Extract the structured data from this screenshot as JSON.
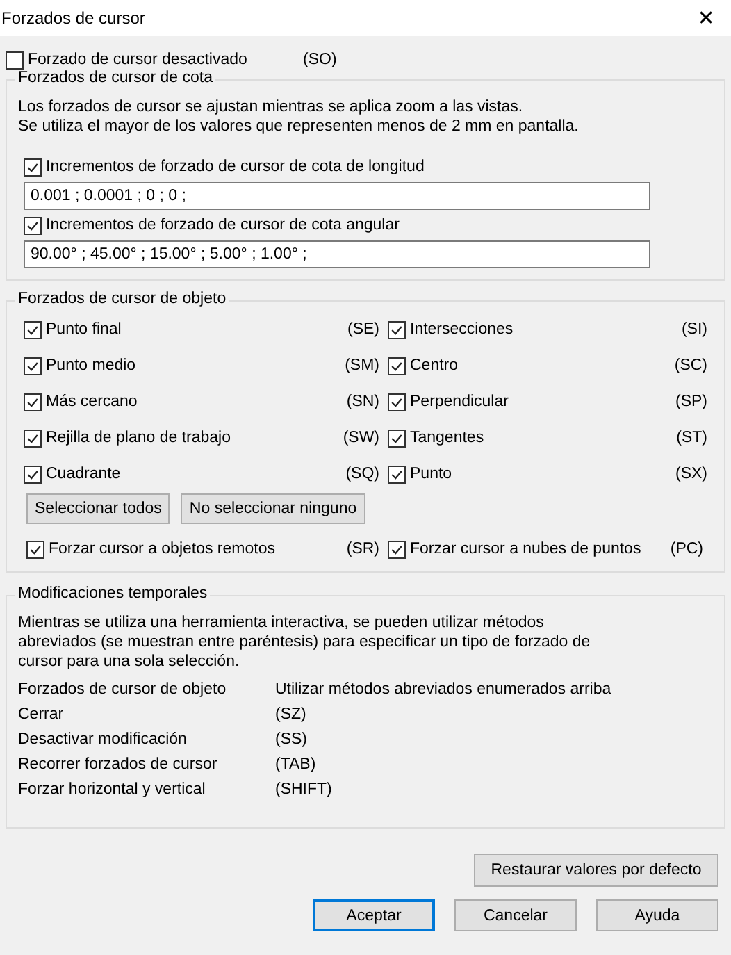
{
  "window": {
    "title": "Forzados de cursor",
    "close": "✕"
  },
  "disable_snap": {
    "label": "Forzado de cursor desactivado",
    "shortcut": "(SO)",
    "checked": false
  },
  "dimension_snaps": {
    "title": "Forzados de cursor de cota",
    "description": "Los forzados de cursor se ajustan mientras se aplica zoom a las vistas.\nSe utiliza el mayor de los valores que representen menos de 2 mm en pantalla.",
    "items": [
      {
        "label": "Incrementos de forzado de cursor de cota de longitud",
        "checked": true,
        "value": "0.001 ; 0.0001 ; 0 ; 0 ;"
      },
      {
        "label": "Incrementos de forzado de cursor de cota angular",
        "checked": true,
        "value": "90.00° ; 45.00° ; 15.00° ; 5.00° ; 1.00° ;"
      }
    ]
  },
  "object_snaps": {
    "title": "Forzados de cursor de objeto",
    "items": [
      {
        "label": "Punto final",
        "shortcut": "(SE)",
        "checked": true
      },
      {
        "label": "Intersecciones",
        "shortcut": "(SI)",
        "checked": true
      },
      {
        "label": "Punto medio",
        "shortcut": "(SM)",
        "checked": true
      },
      {
        "label": "Centro",
        "shortcut": "(SC)",
        "checked": true
      },
      {
        "label": "Más cercano",
        "shortcut": "(SN)",
        "checked": true
      },
      {
        "label": "Perpendicular",
        "shortcut": "(SP)",
        "checked": true
      },
      {
        "label": "Rejilla de plano de trabajo",
        "shortcut": "(SW)",
        "checked": true
      },
      {
        "label": "Tangentes",
        "shortcut": "(ST)",
        "checked": true
      },
      {
        "label": "Cuadrante",
        "shortcut": "(SQ)",
        "checked": true
      },
      {
        "label": "Punto",
        "shortcut": "(SX)",
        "checked": true
      }
    ],
    "buttons": [
      "Seleccionar todos",
      "No seleccionar ninguno"
    ],
    "extra_items": [
      {
        "label": "Forzar cursor a objetos remotos",
        "shortcut": "(SR)",
        "checked": true
      },
      {
        "label": "Forzar cursor a nubes de puntos",
        "shortcut": "(PC)",
        "checked": true
      }
    ]
  },
  "temporary_overrides": {
    "title": "Modificaciones temporales",
    "description": "Mientras se utiliza una herramienta interactiva, se pueden utilizar métodos\nabreviados (se muestran entre paréntesis) para especificar un tipo de forzado de\ncursor para una sola selección.",
    "rows": [
      {
        "name": "Forzados de cursor de objeto",
        "shortcut": "Utilizar métodos abreviados enumerados arriba"
      },
      {
        "name": "Cerrar",
        "shortcut": "(SZ)"
      },
      {
        "name": "Desactivar modificación",
        "shortcut": "(SS)"
      },
      {
        "name": "Recorrer forzados de cursor",
        "shortcut": "(TAB)"
      },
      {
        "name": "Forzar horizontal y vertical",
        "shortcut": "(SHIFT)"
      }
    ]
  },
  "restore_button": "Restaurar valores por defecto",
  "buttons": [
    {
      "label": "Aceptar",
      "default": true
    },
    {
      "label": "Cancelar",
      "default": false
    },
    {
      "label": "Ayuda",
      "default": false
    }
  ]
}
